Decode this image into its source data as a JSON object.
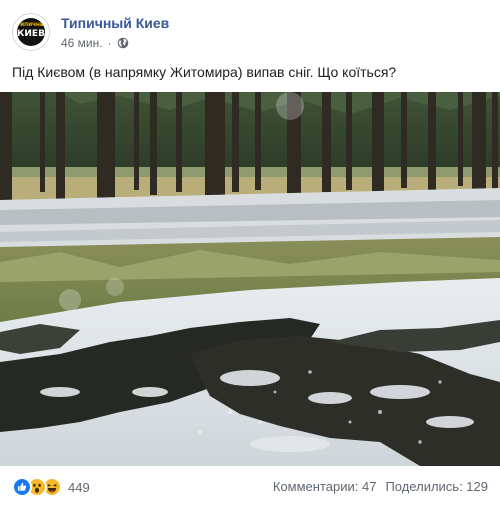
{
  "post": {
    "page_name": "Типичный Киев",
    "avatar": {
      "small_text": "ТИПИЧНЫЙ",
      "big_text": "КИЕВ",
      "accent": "#ffcc00"
    },
    "time": "46 мин.",
    "separator": "·",
    "privacy_icon": "globe-icon",
    "text": "Під Києвом (в напрямку Житомира) випав сніг. Що коїться?"
  },
  "footer": {
    "reaction_icons": [
      "like-icon",
      "wow-icon",
      "haha-icon"
    ],
    "reaction_count": "449",
    "comments": "Комментарии: 47",
    "shares": "Поделились: 129"
  },
  "colors": {
    "page_name": "#385898",
    "meta": "#606770",
    "like": "#1877f2",
    "emoji": "#f7b928"
  }
}
